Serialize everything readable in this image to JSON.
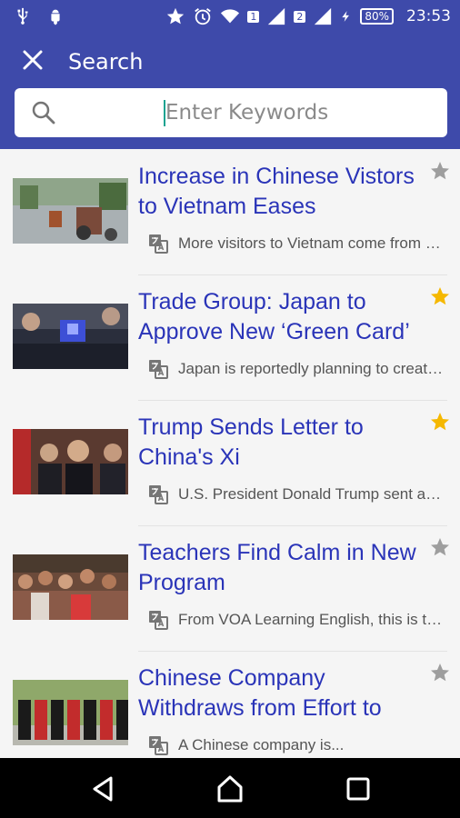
{
  "status_bar": {
    "time": "23:53",
    "battery": "80%",
    "sim1": "1",
    "sim2": "2",
    "icons": [
      "usb-icon",
      "android-icon",
      "star-icon",
      "alarm-icon",
      "wifi-icon",
      "signal-icon",
      "signal-icon",
      "charging-icon",
      "battery-icon"
    ]
  },
  "app_bar": {
    "title": "Search",
    "close_icon": "close-icon"
  },
  "search": {
    "placeholder": "Enter Keywords",
    "value": "",
    "icon": "search-icon"
  },
  "articles": [
    {
      "headline": "Increase in Chinese Vistors to Vietnam Eases",
      "summary": "More visitors to Vietnam come from China...",
      "starred": false
    },
    {
      "headline": "Trade Group: Japan to Approve New ‘Green Card’",
      "summary": "Japan is reportedly planning to create...",
      "starred": true
    },
    {
      "headline": "Trump Sends Letter to China's Xi",
      "summary": "U.S. President Donald Trump sent a letter...",
      "starred": true
    },
    {
      "headline": "Teachers Find Calm in New Program",
      "summary": "From VOA Learning English, this is the...",
      "starred": false
    },
    {
      "headline": "Chinese Company Withdraws from Effort to",
      "summary": "A Chinese company is...",
      "starred": false
    }
  ],
  "colors": {
    "primary": "#3e4aaa",
    "headline": "#2a34b8",
    "star_on": "#f5b800",
    "star_off": "#9e9e9e"
  },
  "nav_bar": {
    "icons": [
      "back-icon",
      "home-icon",
      "recents-icon"
    ]
  }
}
